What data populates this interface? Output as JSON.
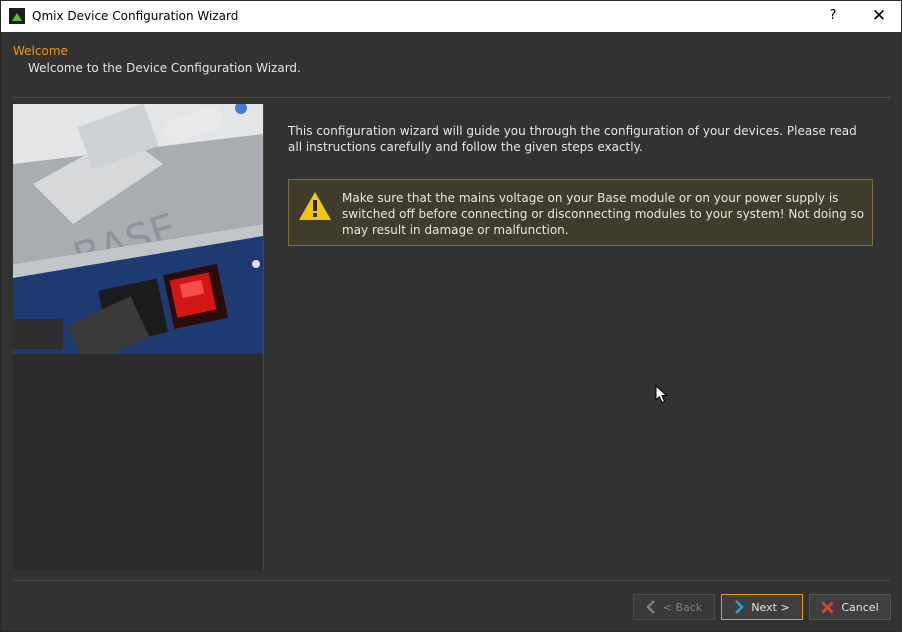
{
  "window": {
    "title": "Qmix Device Configuration Wizard",
    "help_label": "?",
    "close_label": "✕"
  },
  "page": {
    "title": "Welcome",
    "subtitle": "Welcome to the Device Configuration Wizard.",
    "intro": "This configuration wizard will guide you through the configuration of your devices. Please read all instructions carefully and follow the given steps exactly.",
    "warning": "Make sure that the mains voltage on your Base module or on your power supply is switched off before connecting or disconnecting modules to your system! Not doing so may result in damage or malfunction."
  },
  "buttons": {
    "back": "< Back",
    "next": "Next >",
    "cancel": "Cancel"
  },
  "colors": {
    "accent": "#f0961e",
    "background": "#323232",
    "warning_fill": "#403c2c",
    "warning_border": "#7c6f3a",
    "warning_icon": "#f2c417",
    "cancel_icon": "#d9442b",
    "next_icon": "#2f9be0"
  },
  "icons": {
    "app": "qmix-app-icon",
    "warning": "warning-triangle-icon",
    "back": "chevron-left-icon",
    "next": "chevron-right-icon",
    "cancel": "red-x-icon"
  }
}
